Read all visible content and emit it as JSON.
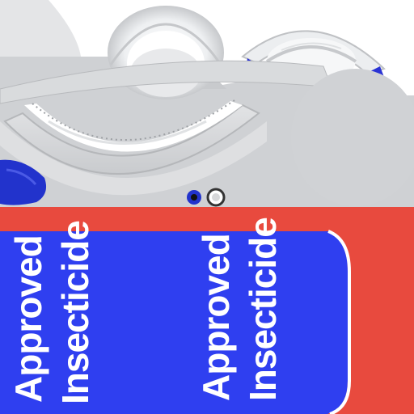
{
  "labels": {
    "left": "Approved\nInsecticide",
    "right": "Approved\nInsecticide"
  },
  "colors": {
    "band_red": "#e84a3e",
    "label_blue": "#2f3ff0",
    "light_gray": "#d2d4d6",
    "white": "#ffffff"
  }
}
